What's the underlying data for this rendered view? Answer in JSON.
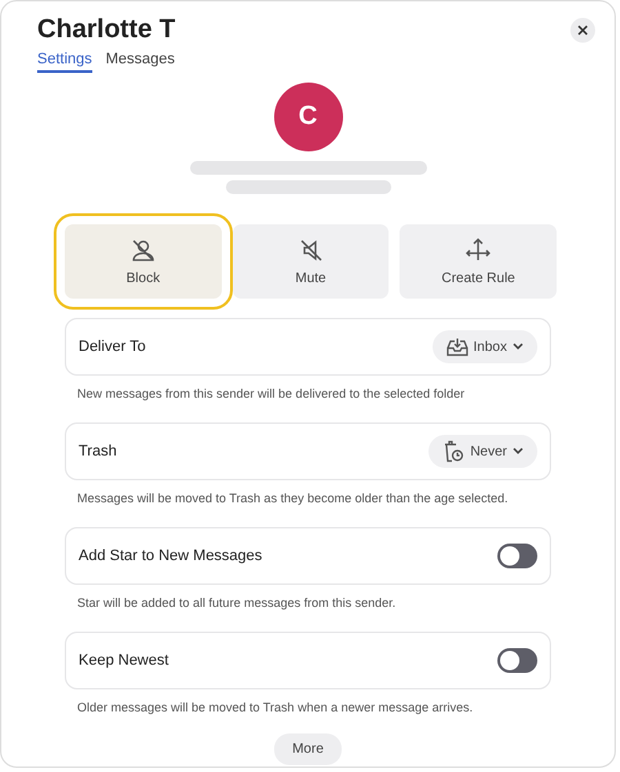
{
  "title": "Charlotte T",
  "tabs": [
    {
      "label": "Settings",
      "selected": true
    },
    {
      "label": "Messages",
      "selected": false
    }
  ],
  "avatar": {
    "initial": "C",
    "color": "#cc2f5a"
  },
  "actions": [
    {
      "label": "Block",
      "kind": "block",
      "selected": true
    },
    {
      "label": "Mute",
      "kind": "mute",
      "selected": false
    },
    {
      "label": "Create Rule",
      "kind": "rule",
      "selected": false
    }
  ],
  "settings": [
    {
      "kind": "dropdown",
      "label": "Deliver To",
      "value": "Inbox",
      "description": "New messages from this sender will be delivered to the selected folder"
    },
    {
      "kind": "dropdown",
      "label": "Trash",
      "value": "Never",
      "description": "Messages will be moved to Trash as they become older than the age selected."
    },
    {
      "kind": "toggle",
      "label": "Add Star to New Messages",
      "on": false,
      "description": "Star will be added to all future messages from this sender."
    },
    {
      "kind": "toggle",
      "label": "Keep Newest",
      "on": false,
      "description": "Older messages will be moved to Trash when a newer message arrives."
    }
  ],
  "more_button": "More"
}
